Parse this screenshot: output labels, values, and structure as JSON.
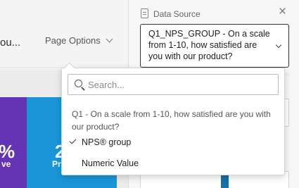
{
  "canvas": {
    "page_title": "ou...",
    "page_options_label": "Page Options",
    "tile1_value": "%",
    "tile1_label": "ve",
    "tile2_value": "2",
    "tile2_label": "Pr"
  },
  "panel": {
    "data_source_label": "Data Source",
    "close_symbol": "×",
    "selected_source": "Q1_NPS_GROUP - On a scale from 1-10, how satisfied are you with our product?"
  },
  "dropdown": {
    "search_placeholder": "Search...",
    "group_header": "Q1 - On a scale from 1-10, how satisfied are you with our product?",
    "options": [
      {
        "label": "NPS® group",
        "selected": true
      },
      {
        "label": "Numeric Value",
        "selected": false
      }
    ]
  },
  "colors": {
    "tile_purple": "#6434b4",
    "tile_blue": "#1a96d8",
    "panel_bg": "#f7f7f7"
  },
  "icons": {
    "data_source": "clipboard-icon",
    "close": "close-icon",
    "search": "search-icon",
    "check": "check-icon",
    "chevron": "chevron-down-icon"
  }
}
